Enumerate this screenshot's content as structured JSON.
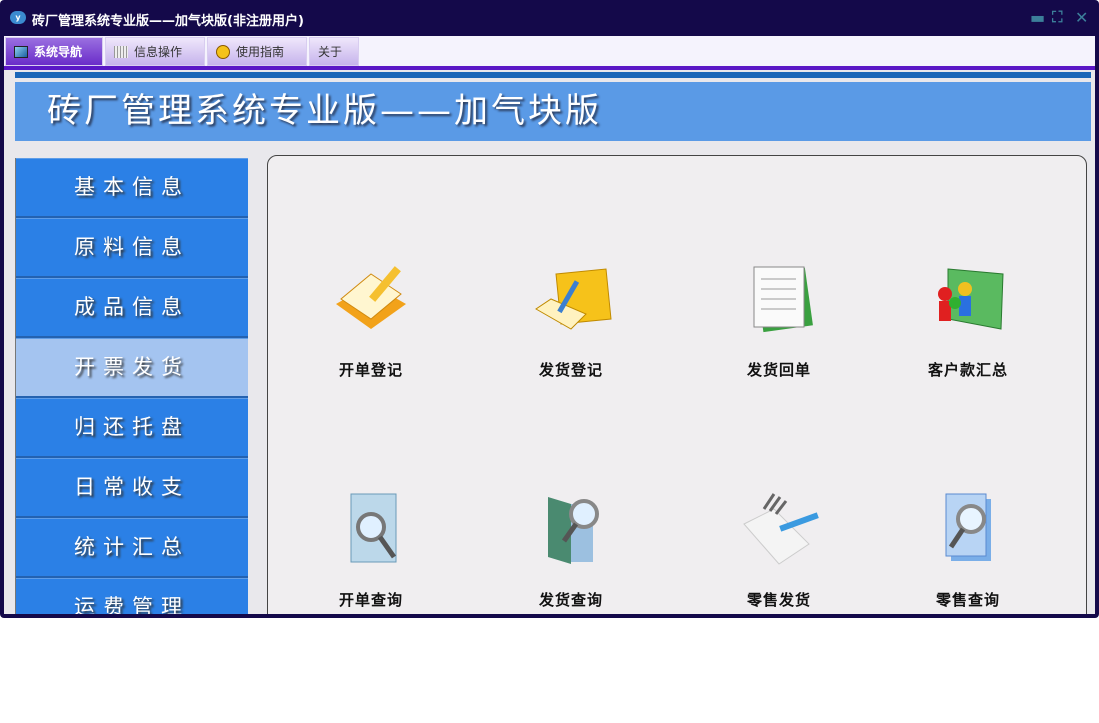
{
  "window": {
    "title": "砖厂管理系统专业版——加气块版(非注册用户)",
    "controls": [
      "minimize",
      "restore",
      "close"
    ]
  },
  "tabs": [
    {
      "label": "系统导航",
      "active": true
    },
    {
      "label": "信息操作"
    },
    {
      "label": "使用指南"
    },
    {
      "label": "关于"
    }
  ],
  "banner": "砖厂管理系统专业版——加气块版",
  "sidebar": [
    {
      "label": "基本信息"
    },
    {
      "label": "原料信息"
    },
    {
      "label": "成品信息"
    },
    {
      "label": "开票发货",
      "selected": true
    },
    {
      "label": "归还托盘"
    },
    {
      "label": "日常收支"
    },
    {
      "label": "统计汇总"
    },
    {
      "label": "运费管理"
    }
  ],
  "tiles": [
    {
      "label": "开单登记",
      "icon": "notebook-pencil-icon"
    },
    {
      "label": "发货登记",
      "icon": "folder-pen-icon"
    },
    {
      "label": "发货回单",
      "icon": "documents-icon"
    },
    {
      "label": "客户款汇总",
      "icon": "customers-folder-icon"
    },
    {
      "label": "开单查询",
      "icon": "document-search-icon"
    },
    {
      "label": "发货查询",
      "icon": "book-search-icon"
    },
    {
      "label": "零售发货",
      "icon": "paper-pen-icon"
    },
    {
      "label": "零售查询",
      "icon": "files-search-icon"
    }
  ]
}
